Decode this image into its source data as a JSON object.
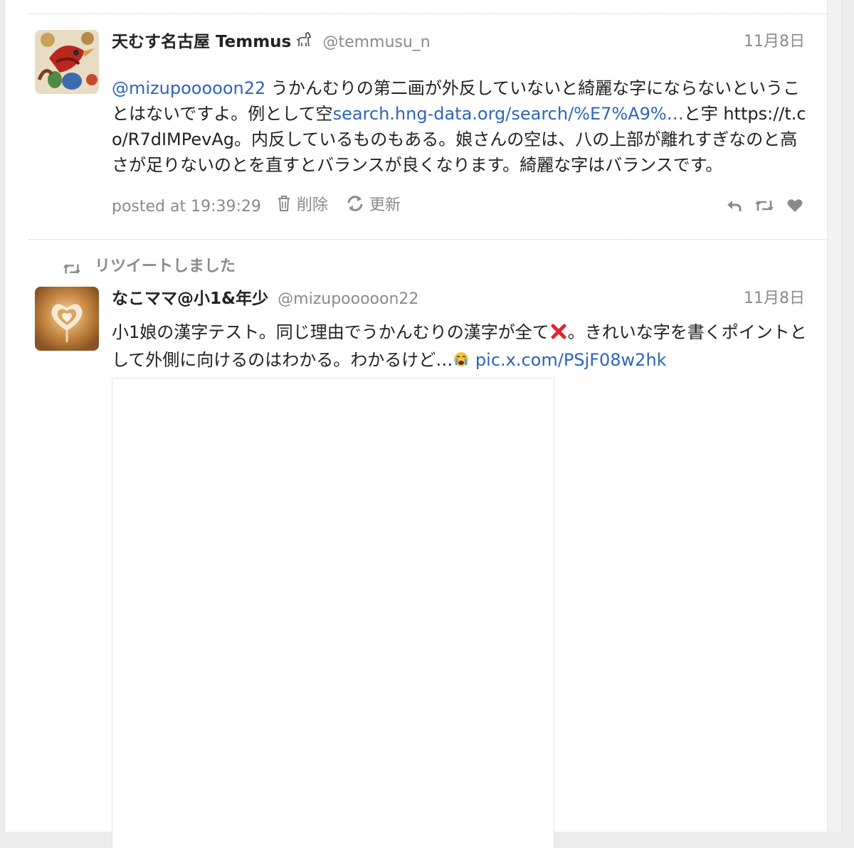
{
  "tweet1": {
    "display_name": "天むす名古屋 Temmus",
    "screen_name": "@temmusu_n",
    "date": "11月8日",
    "mention": "@mizupooooon22",
    "text_a": " うかんむりの第二画が外反していないと綺麗な字にならないということはないですよ。例として空",
    "link1": "search.hng-data.org/search/%E7%A9%…",
    "text_b": "と宇 https://t.co/R7dIMPevAg。内反しているものもある。娘さんの空は、八の上部が離れすぎなのと高さが足りないのとを直すとバランスが良くなります。綺麗な字はバランスです。",
    "posted_label": "posted at 19:39:29",
    "delete_label": "削除",
    "refresh_label": "更新"
  },
  "retweet_notice": "リツイートしました",
  "tweet2": {
    "display_name": "なこママ@小1&年少",
    "screen_name": "@mizupooooon22",
    "date": "11月8日",
    "text_a": "小1娘の漢字テスト。同じ理由でうかんむりの漢字が全て",
    "text_b": "。きれいな字を書くポイントとして外側に向けるのはわかる。わかるけど…",
    "link": "pic.x.com/PSjF08w2hk"
  },
  "icons": {
    "name_badge": "dog-icon",
    "trash": "trash-icon",
    "refresh": "refresh-icon",
    "reply": "reply-icon",
    "retweet": "retweet-icon",
    "like": "heart-icon",
    "cross": "cross-mark-icon",
    "crying": "crying-face-icon"
  },
  "colors": {
    "link": "#2e64b8",
    "muted": "#8a8a8a",
    "cross": "#e0262b"
  }
}
